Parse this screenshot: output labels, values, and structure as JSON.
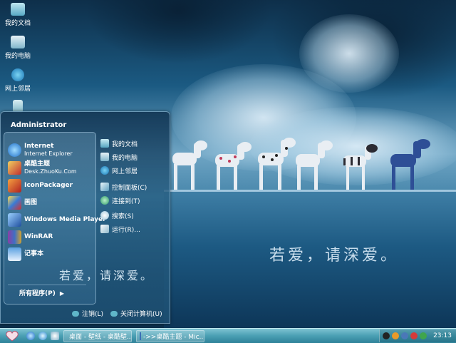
{
  "desktop": {
    "icons": [
      {
        "label": "我的文档",
        "icon": "folder-icon"
      },
      {
        "label": "我的电脑",
        "icon": "computer-icon"
      },
      {
        "label": "网上邻居",
        "icon": "network-globe-icon"
      },
      {
        "label": "",
        "icon": "recycle-bin-icon"
      }
    ]
  },
  "wallpaper": {
    "caption": "若爱，请深爱。"
  },
  "start_menu": {
    "user": "Administrator",
    "pinned": [
      {
        "title": "Internet",
        "subtitle": "Internet Explorer",
        "icon": "ie-icon"
      },
      {
        "title": "桌酷主题",
        "subtitle": "Desk.ZhuoKu.Com",
        "icon": "zhuoku-theme-icon"
      }
    ],
    "programs": [
      {
        "title": "IconPackager",
        "icon": "iconpackager-icon"
      },
      {
        "title": "画图",
        "icon": "paint-icon"
      },
      {
        "title": "Windows Media Player",
        "icon": "media-player-icon"
      },
      {
        "title": "WinRAR",
        "icon": "winrar-icon"
      },
      {
        "title": "记事本",
        "icon": "notepad-icon"
      }
    ],
    "all_programs": "所有程序(P)",
    "right_items": [
      {
        "label": "我的文档",
        "icon": "folder-icon"
      },
      {
        "label": "我的电脑",
        "icon": "computer-icon"
      },
      {
        "label": "网上邻居",
        "icon": "network-globe-icon"
      },
      {
        "label": "控制面板(C)",
        "icon": "control-panel-icon"
      },
      {
        "label": "连接到(T)",
        "icon": "connect-icon"
      },
      {
        "label": "搜索(S)",
        "icon": "search-icon"
      },
      {
        "label": "运行(R)...",
        "icon": "run-icon"
      }
    ],
    "caption": "若爱，请深爱。",
    "logoff": "注销(L)",
    "shutdown": "关闭计算机(U)"
  },
  "taskbar": {
    "tasks": [
      "桌面 - 壁纸 - 桌酷壁...",
      "->>桌酷主题 - Mic..."
    ],
    "clock": "23:13"
  },
  "colors": {
    "taskbar": "#4a9fb3",
    "start_menu": "#1e4f74",
    "accent": "#5fb6c9"
  }
}
